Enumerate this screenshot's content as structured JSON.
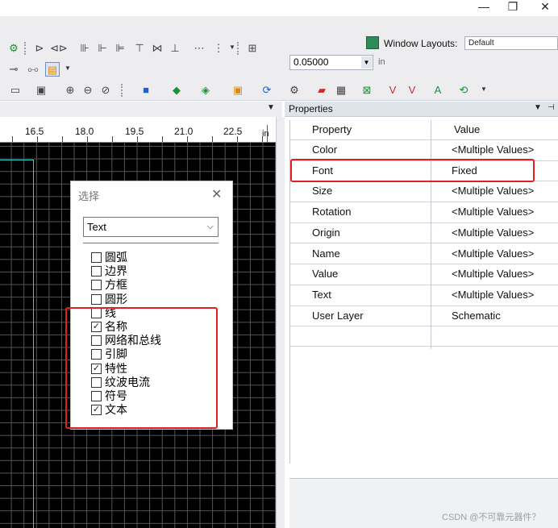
{
  "window": {
    "minimize": "—",
    "maximize": "❐",
    "close": "✕"
  },
  "toolbar": {
    "window_layouts_label": "Window Layouts:",
    "window_layouts_value": "Default",
    "grid_value": "0.05000",
    "unit_label": "in"
  },
  "canvas": {
    "ruler_labels": [
      "16.5",
      "18.0",
      "19.5",
      "21.0",
      "22.5",
      "in"
    ]
  },
  "select_dialog": {
    "title": "选择",
    "dropdown_value": "Text",
    "items": [
      {
        "label": "圆弧",
        "checked": false
      },
      {
        "label": "边界",
        "checked": false
      },
      {
        "label": "方框",
        "checked": false
      },
      {
        "label": "圆形",
        "checked": false
      },
      {
        "label": "线",
        "checked": false
      },
      {
        "label": "名称",
        "checked": true
      },
      {
        "label": "网络和总线",
        "checked": false
      },
      {
        "label": "引脚",
        "checked": false
      },
      {
        "label": "特性",
        "checked": true
      },
      {
        "label": "纹波电流",
        "checked": false
      },
      {
        "label": "符号",
        "checked": false
      },
      {
        "label": "文本",
        "checked": true
      }
    ],
    "highlight_color": "#e02020"
  },
  "properties": {
    "panel_title": "Properties",
    "col_property": "Property",
    "col_value": "Value",
    "rows": [
      {
        "name": "Color",
        "value": "<Multiple Values>"
      },
      {
        "name": "Font",
        "value": "Fixed"
      },
      {
        "name": "Size",
        "value": "<Multiple Values>"
      },
      {
        "name": "Rotation",
        "value": "<Multiple Values>"
      },
      {
        "name": "Origin",
        "value": "<Multiple Values>"
      },
      {
        "name": "Name",
        "value": "<Multiple Values>"
      },
      {
        "name": "Value",
        "value": "<Multiple Values>"
      },
      {
        "name": "Text",
        "value": "<Multiple Values>"
      },
      {
        "name": "User Layer",
        "value": "Schematic"
      }
    ]
  },
  "watermark": "CSDN @不可靠元器件？"
}
